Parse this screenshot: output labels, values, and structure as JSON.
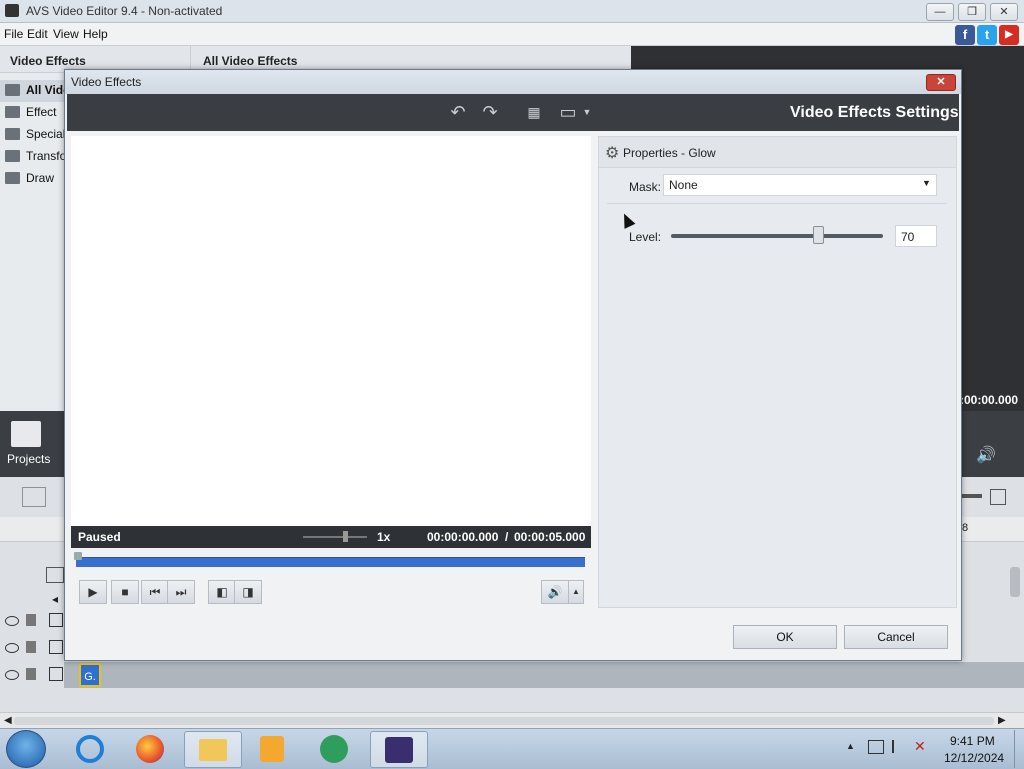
{
  "app": {
    "title": "AVS Video Editor 9.4 - Non-activated",
    "menu": [
      "File",
      "Edit",
      "View",
      "Help"
    ],
    "window_buttons": {
      "minimize": "—",
      "restore": "❐",
      "close": "✕"
    },
    "social": [
      {
        "name": "facebook-icon",
        "glyph": "f",
        "color": "#3b5998"
      },
      {
        "name": "twitter-icon",
        "glyph": "t",
        "color": "#2aa3ef"
      },
      {
        "name": "youtube-icon",
        "glyph": "▶",
        "color": "#d62d20"
      }
    ]
  },
  "left_panel": {
    "header": "Video Effects",
    "categories": [
      "All Vide",
      "Effect",
      "Special",
      "Transfo",
      "Draw"
    ]
  },
  "mid_panel": {
    "header": "All Video Effects"
  },
  "projects_label": "Projects",
  "timecode_right": ":00:00.000",
  "ruler_mark": "8",
  "clip_label": "G.",
  "dialog": {
    "title": "Video Effects",
    "close": "✕",
    "settings_title": "Video Effects Settings",
    "player": {
      "status": "Paused",
      "speed": "1x",
      "current_time": "00:00:00.000",
      "separator": "/",
      "total_time": "00:00:05.000"
    },
    "properties": {
      "title": "Properties - Glow",
      "mask_label": "Mask:",
      "mask_value": "None",
      "level_label": "Level:",
      "level_value": "70",
      "level_fraction": 0.7
    },
    "ok": "OK",
    "cancel": "Cancel"
  },
  "taskbar": {
    "time": "9:41 PM",
    "date": "12/12/2024"
  }
}
